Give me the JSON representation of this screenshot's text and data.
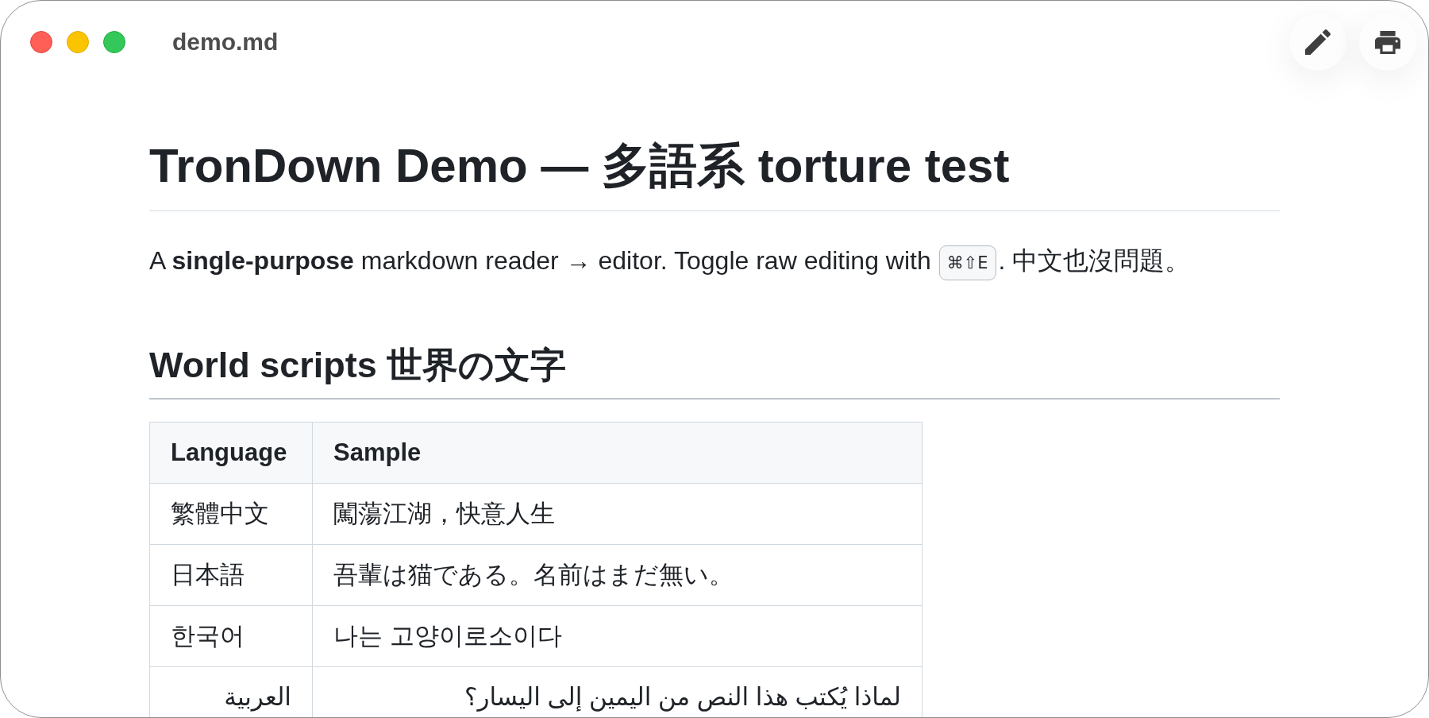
{
  "window": {
    "title": "demo.md",
    "controls": [
      {
        "kind": "close"
      },
      {
        "kind": "minimize"
      },
      {
        "kind": "zoom"
      }
    ]
  },
  "toolbar": [
    {
      "kind": "edit"
    },
    {
      "kind": "print"
    }
  ],
  "document": {
    "title": "TronDown Demo — 多語系 torture test",
    "intro": [
      {
        "kind": "text",
        "text": "A **single-purpose** markdown reader → editor. Toggle raw editing with"
      },
      {
        "kind": "kbd",
        "text": "⌘⇧E"
      },
      {
        "kind": "text",
        "text": ". 中文也沒問題。"
      }
    ],
    "sections": [
      {
        "heading": "World scripts 世界の文字",
        "table": {
          "columns": [
            "Language",
            "Sample"
          ],
          "rows": [
            [
              "繁體中文",
              "闖蕩江湖，快意人生"
            ],
            [
              "日本語",
              "吾輩は猫である。名前はまだ無い。"
            ],
            [
              "한국어",
              "나는 고양이로소이다"
            ],
            [
              "العربية",
              "لماذا يُكتب هذا النص من اليمين إلى اليسار؟"
            ]
          ]
        }
      }
    ]
  }
}
